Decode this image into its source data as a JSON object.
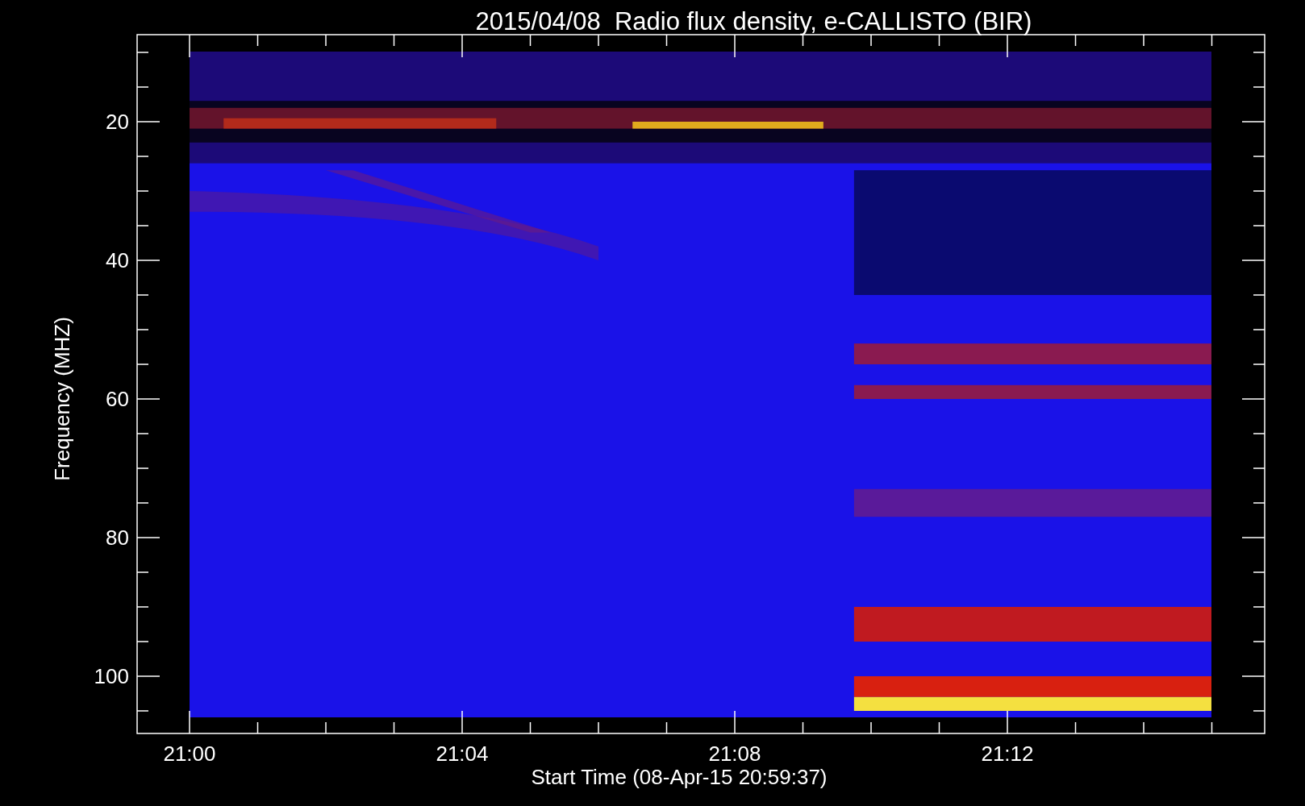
{
  "title": "2015/04/08  Radio flux density, e-CALLISTO (BIR)",
  "y_axis": {
    "label": "Frequency (MHZ)",
    "ticks": [
      "20",
      "40",
      "60",
      "80",
      "100"
    ]
  },
  "x_axis": {
    "label": "Start Time (08-Apr-15 20:59:37)",
    "ticks": [
      "21:00",
      "21:04",
      "21:08",
      "21:12"
    ]
  }
}
